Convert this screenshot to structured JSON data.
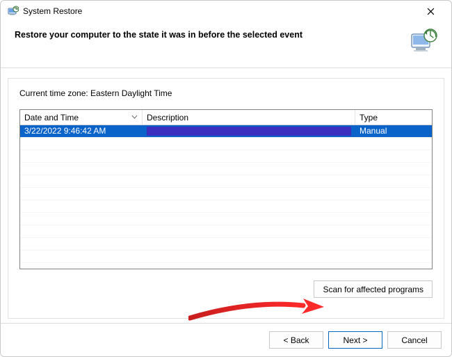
{
  "window": {
    "title": "System Restore"
  },
  "header": {
    "heading": "Restore your computer to the state it was in before the selected event"
  },
  "body": {
    "timezone_label": "Current time zone: Eastern Daylight Time",
    "columns": {
      "datetime": "Date and Time",
      "description": "Description",
      "type": "Type"
    },
    "rows": [
      {
        "datetime": "3/22/2022 9:46:42 AM",
        "description": "",
        "type": "Manual",
        "redacted": true
      }
    ],
    "scan_button": "Scan for affected programs"
  },
  "footer": {
    "back": "< Back",
    "next": "Next >",
    "cancel": "Cancel"
  }
}
